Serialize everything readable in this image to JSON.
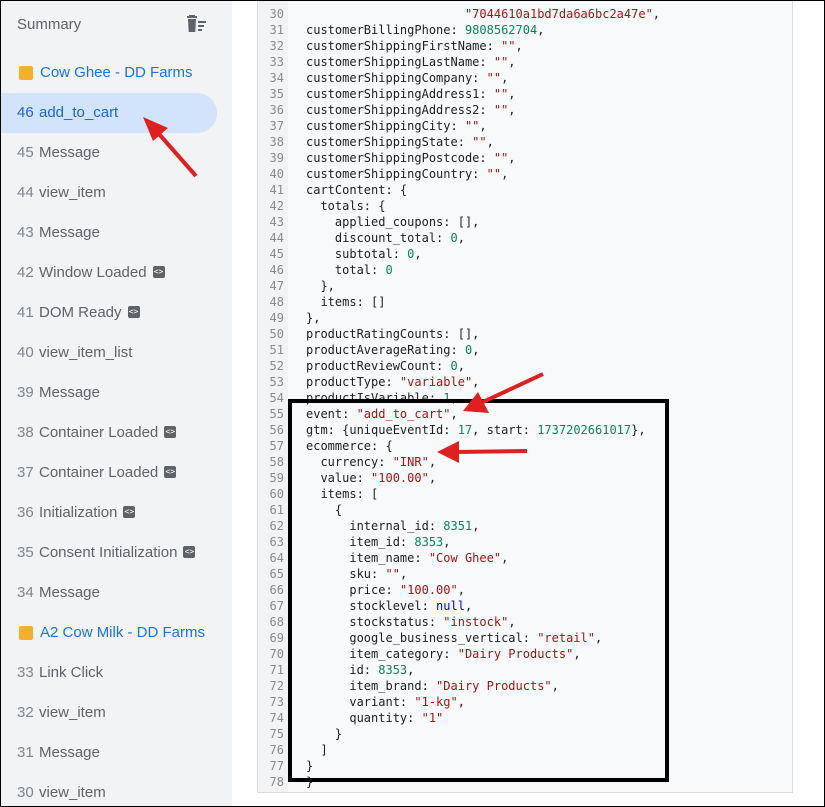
{
  "sidebar": {
    "summary_label": "Summary",
    "items": [
      {
        "type": "container",
        "label": "Cow Ghee - DD Farms"
      },
      {
        "type": "event",
        "num": "46",
        "label": "add_to_cart",
        "selected": true
      },
      {
        "type": "event",
        "num": "45",
        "label": "Message"
      },
      {
        "type": "event",
        "num": "44",
        "label": "view_item"
      },
      {
        "type": "event",
        "num": "43",
        "label": "Message"
      },
      {
        "type": "event",
        "num": "42",
        "label": "Window Loaded",
        "badge": true
      },
      {
        "type": "event",
        "num": "41",
        "label": "DOM Ready",
        "badge": true
      },
      {
        "type": "event",
        "num": "40",
        "label": "view_item_list"
      },
      {
        "type": "event",
        "num": "39",
        "label": "Message"
      },
      {
        "type": "event",
        "num": "38",
        "label": "Container Loaded",
        "badge": true
      },
      {
        "type": "event",
        "num": "37",
        "label": "Container Loaded",
        "badge": true
      },
      {
        "type": "event",
        "num": "36",
        "label": "Initialization",
        "badge": true
      },
      {
        "type": "event",
        "num": "35",
        "label": "Consent Initialization",
        "badge": true
      },
      {
        "type": "event",
        "num": "34",
        "label": "Message"
      },
      {
        "type": "container",
        "label": "A2 Cow Milk - DD Farms"
      },
      {
        "type": "event",
        "num": "33",
        "label": "Link Click"
      },
      {
        "type": "event",
        "num": "32",
        "label": "view_item"
      },
      {
        "type": "event",
        "num": "31",
        "label": "Message"
      },
      {
        "type": "event",
        "num": "30",
        "label": "view_item"
      }
    ]
  },
  "code": {
    "lines": [
      {
        "ln": "30",
        "parts": [
          [
            "p",
            "                      "
          ],
          [
            "s",
            "\"7044610a1bd7da6a6bc2a47e\""
          ],
          [
            "p",
            ","
          ]
        ]
      },
      {
        "ln": "31",
        "parts": [
          [
            "p",
            "customerBillingPhone: "
          ],
          [
            "n",
            "9808562704"
          ],
          [
            "p",
            ","
          ]
        ]
      },
      {
        "ln": "32",
        "parts": [
          [
            "p",
            "customerShippingFirstName: "
          ],
          [
            "s",
            "\"\""
          ],
          [
            "p",
            ","
          ]
        ]
      },
      {
        "ln": "33",
        "parts": [
          [
            "p",
            "customerShippingLastName: "
          ],
          [
            "s",
            "\"\""
          ],
          [
            "p",
            ","
          ]
        ]
      },
      {
        "ln": "34",
        "parts": [
          [
            "p",
            "customerShippingCompany: "
          ],
          [
            "s",
            "\"\""
          ],
          [
            "p",
            ","
          ]
        ]
      },
      {
        "ln": "35",
        "parts": [
          [
            "p",
            "customerShippingAddress1: "
          ],
          [
            "s",
            "\"\""
          ],
          [
            "p",
            ","
          ]
        ]
      },
      {
        "ln": "36",
        "parts": [
          [
            "p",
            "customerShippingAddress2: "
          ],
          [
            "s",
            "\"\""
          ],
          [
            "p",
            ","
          ]
        ]
      },
      {
        "ln": "37",
        "parts": [
          [
            "p",
            "customerShippingCity: "
          ],
          [
            "s",
            "\"\""
          ],
          [
            "p",
            ","
          ]
        ]
      },
      {
        "ln": "38",
        "parts": [
          [
            "p",
            "customerShippingState: "
          ],
          [
            "s",
            "\"\""
          ],
          [
            "p",
            ","
          ]
        ]
      },
      {
        "ln": "39",
        "parts": [
          [
            "p",
            "customerShippingPostcode: "
          ],
          [
            "s",
            "\"\""
          ],
          [
            "p",
            ","
          ]
        ]
      },
      {
        "ln": "40",
        "parts": [
          [
            "p",
            "customerShippingCountry: "
          ],
          [
            "s",
            "\"\""
          ],
          [
            "p",
            ","
          ]
        ]
      },
      {
        "ln": "41",
        "parts": [
          [
            "p",
            "cartContent: {"
          ]
        ]
      },
      {
        "ln": "42",
        "parts": [
          [
            "p",
            "  totals: {"
          ]
        ]
      },
      {
        "ln": "43",
        "parts": [
          [
            "p",
            "    applied_coupons: [],"
          ]
        ]
      },
      {
        "ln": "44",
        "parts": [
          [
            "p",
            "    discount_total: "
          ],
          [
            "n",
            "0"
          ],
          [
            "p",
            ","
          ]
        ]
      },
      {
        "ln": "45",
        "parts": [
          [
            "p",
            "    subtotal: "
          ],
          [
            "n",
            "0"
          ],
          [
            "p",
            ","
          ]
        ]
      },
      {
        "ln": "46",
        "parts": [
          [
            "p",
            "    total: "
          ],
          [
            "n",
            "0"
          ]
        ]
      },
      {
        "ln": "47",
        "parts": [
          [
            "p",
            "  },"
          ]
        ]
      },
      {
        "ln": "48",
        "parts": [
          [
            "p",
            "  items: []"
          ]
        ]
      },
      {
        "ln": "49",
        "parts": [
          [
            "p",
            "},"
          ]
        ]
      },
      {
        "ln": "50",
        "parts": [
          [
            "p",
            "productRatingCounts: [],"
          ]
        ]
      },
      {
        "ln": "51",
        "parts": [
          [
            "p",
            "productAverageRating: "
          ],
          [
            "n",
            "0"
          ],
          [
            "p",
            ","
          ]
        ]
      },
      {
        "ln": "52",
        "parts": [
          [
            "p",
            "productReviewCount: "
          ],
          [
            "n",
            "0"
          ],
          [
            "p",
            ","
          ]
        ]
      },
      {
        "ln": "53",
        "parts": [
          [
            "p",
            "productType: "
          ],
          [
            "s",
            "\"variable\""
          ],
          [
            "p",
            ","
          ]
        ]
      },
      {
        "ln": "54",
        "parts": [
          [
            "p",
            "productIsVariable: "
          ],
          [
            "n",
            "1"
          ],
          [
            "p",
            ","
          ]
        ]
      },
      {
        "ln": "55",
        "parts": [
          [
            "p",
            "event: "
          ],
          [
            "s",
            "\"add_to_cart\""
          ],
          [
            "p",
            ","
          ]
        ]
      },
      {
        "ln": "56",
        "parts": [
          [
            "p",
            "gtm: {uniqueEventId: "
          ],
          [
            "n",
            "17"
          ],
          [
            "p",
            ", start: "
          ],
          [
            "n",
            "1737202661017"
          ],
          [
            "p",
            "},"
          ]
        ]
      },
      {
        "ln": "57",
        "parts": [
          [
            "p",
            "ecommerce: {"
          ]
        ]
      },
      {
        "ln": "58",
        "parts": [
          [
            "p",
            "  currency: "
          ],
          [
            "s",
            "\"INR\""
          ],
          [
            "p",
            ","
          ]
        ]
      },
      {
        "ln": "59",
        "parts": [
          [
            "p",
            "  value: "
          ],
          [
            "s",
            "\"100.00\""
          ],
          [
            "p",
            ","
          ]
        ]
      },
      {
        "ln": "60",
        "parts": [
          [
            "p",
            "  items: ["
          ]
        ]
      },
      {
        "ln": "61",
        "parts": [
          [
            "p",
            "    {"
          ]
        ]
      },
      {
        "ln": "62",
        "parts": [
          [
            "p",
            "      internal_id: "
          ],
          [
            "n",
            "8351"
          ],
          [
            "p",
            ","
          ]
        ]
      },
      {
        "ln": "63",
        "parts": [
          [
            "p",
            "      item_id: "
          ],
          [
            "n",
            "8353"
          ],
          [
            "p",
            ","
          ]
        ]
      },
      {
        "ln": "64",
        "parts": [
          [
            "p",
            "      item_name: "
          ],
          [
            "s",
            "\"Cow Ghee\""
          ],
          [
            "p",
            ","
          ]
        ]
      },
      {
        "ln": "65",
        "parts": [
          [
            "p",
            "      sku: "
          ],
          [
            "s",
            "\"\""
          ],
          [
            "p",
            ","
          ]
        ]
      },
      {
        "ln": "66",
        "parts": [
          [
            "p",
            "      price: "
          ],
          [
            "s",
            "\"100.00\""
          ],
          [
            "p",
            ","
          ]
        ]
      },
      {
        "ln": "67",
        "parts": [
          [
            "p",
            "      stocklevel: "
          ],
          [
            "k",
            "null"
          ],
          [
            "p",
            ","
          ]
        ]
      },
      {
        "ln": "68",
        "parts": [
          [
            "p",
            "      stockstatus: "
          ],
          [
            "s",
            "\"instock\""
          ],
          [
            "p",
            ","
          ]
        ]
      },
      {
        "ln": "69",
        "parts": [
          [
            "p",
            "      google_business_vertical: "
          ],
          [
            "s",
            "\"retail\""
          ],
          [
            "p",
            ","
          ]
        ]
      },
      {
        "ln": "70",
        "parts": [
          [
            "p",
            "      item_category: "
          ],
          [
            "s",
            "\"Dairy Products\""
          ],
          [
            "p",
            ","
          ]
        ]
      },
      {
        "ln": "71",
        "parts": [
          [
            "p",
            "      id: "
          ],
          [
            "n",
            "8353"
          ],
          [
            "p",
            ","
          ]
        ]
      },
      {
        "ln": "72",
        "parts": [
          [
            "p",
            "      item_brand: "
          ],
          [
            "s",
            "\"Dairy Products\""
          ],
          [
            "p",
            ","
          ]
        ]
      },
      {
        "ln": "73",
        "parts": [
          [
            "p",
            "      variant: "
          ],
          [
            "s",
            "\"1-kg\""
          ],
          [
            "p",
            ","
          ]
        ]
      },
      {
        "ln": "74",
        "parts": [
          [
            "p",
            "      quantity: "
          ],
          [
            "s",
            "\"1\""
          ]
        ]
      },
      {
        "ln": "75",
        "parts": [
          [
            "p",
            "    }"
          ]
        ]
      },
      {
        "ln": "76",
        "parts": [
          [
            "p",
            "  ]"
          ]
        ]
      },
      {
        "ln": "77",
        "parts": [
          [
            "p",
            "}"
          ]
        ]
      },
      {
        "ln": "78",
        "parts": [
          [
            "p",
            "}"
          ]
        ]
      }
    ]
  },
  "colors": {
    "accent": "#1a73e8",
    "selected_bg": "#d2e3fc",
    "container_square": "#f6ae2d",
    "annotation_arrow": "#e02020",
    "string": "#a31515",
    "number": "#098658",
    "keyword": "#0000ff"
  },
  "icons": {
    "clear": "trash-icon",
    "badge": "code-badge-icon"
  }
}
